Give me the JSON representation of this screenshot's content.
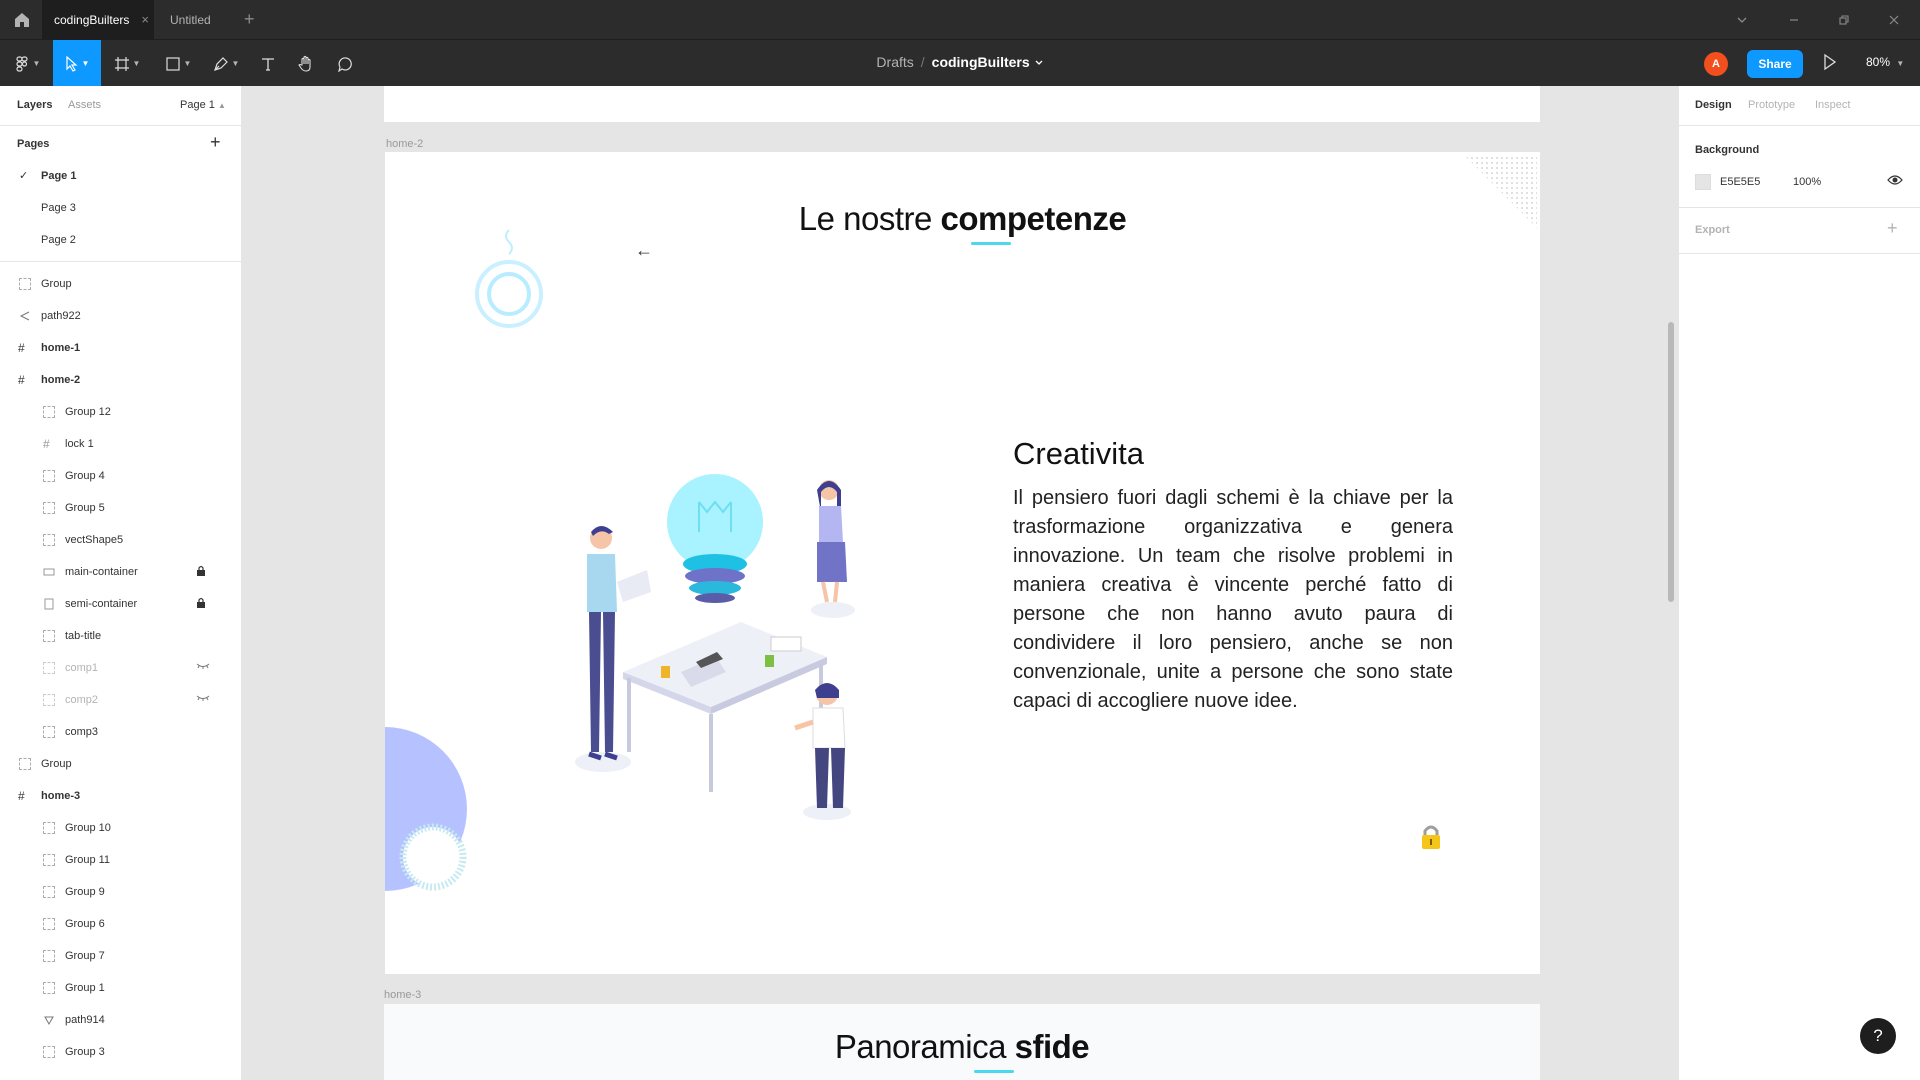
{
  "titlebar": {
    "tabs": [
      {
        "label": "codingBuilters",
        "close": "×"
      },
      {
        "label": "Untitled"
      }
    ],
    "new_tab": "+"
  },
  "toolbar": {
    "breadcrumb_folder": "Drafts",
    "breadcrumb_sep": "/",
    "file_name": "codingBuilters",
    "avatar_initial": "A",
    "share_label": "Share",
    "zoom_label": "80%"
  },
  "left_panel": {
    "tabs": [
      "Layers",
      "Assets"
    ],
    "page_selector": "Page 1",
    "pages_heading": "Pages",
    "add": "+",
    "pages": [
      {
        "label": "Page 1",
        "check": "✓"
      },
      {
        "label": "Page 3"
      },
      {
        "label": "Page 2"
      }
    ],
    "layers": [
      {
        "label": "Group"
      },
      {
        "label": "path922"
      },
      {
        "label": "home-1"
      },
      {
        "label": "home-2"
      },
      {
        "label": "Group 12"
      },
      {
        "label": "lock 1"
      },
      {
        "label": "Group 4"
      },
      {
        "label": "Group 5"
      },
      {
        "label": "vectShape5"
      },
      {
        "label": "main-container"
      },
      {
        "label": "semi-container"
      },
      {
        "label": "tab-title"
      },
      {
        "label": "comp1"
      },
      {
        "label": "comp2"
      },
      {
        "label": "comp3"
      },
      {
        "label": "Group"
      },
      {
        "label": "home-3"
      },
      {
        "label": "Group 10"
      },
      {
        "label": "Group 11"
      },
      {
        "label": "Group 9"
      },
      {
        "label": "Group 6"
      },
      {
        "label": "Group 7"
      },
      {
        "label": "Group 1"
      },
      {
        "label": "path914"
      },
      {
        "label": "Group 3"
      }
    ]
  },
  "canvas": {
    "frame_label_home2": "home-2",
    "frame_label_home3": "home-3",
    "home2": {
      "title_regular": "Le nostre",
      "title_bold": "competenze",
      "back_arrow": "←",
      "card_title": "Creativita",
      "card_body": "Il pensiero fuori dagli schemi è la chiave per la trasformazione organizzativa e genera innovazione. Un team che risolve problemi in maniera creativa è vincente perché fatto di persone che non hanno avuto paura di condividere il loro pensiero, anche se non convenzionale, unite a persone che sono state capaci di accogliere nuove idee."
    },
    "home3": {
      "title_regular": "Panoramica",
      "title_bold": "sfide"
    }
  },
  "right_panel": {
    "tabs": [
      "Design",
      "Prototype",
      "Inspect"
    ],
    "background_heading": "Background",
    "background_hex": "E5E5E5",
    "background_opacity": "100%",
    "export_heading": "Export",
    "add": "+"
  },
  "help_label": "?",
  "colors": {
    "accent": "#0d99ff",
    "titlebar": "#2c2c2c",
    "canvas_bg": "#e5e5e5",
    "title_underline": "#4ad8ee",
    "avatar": "#f24e1e"
  }
}
